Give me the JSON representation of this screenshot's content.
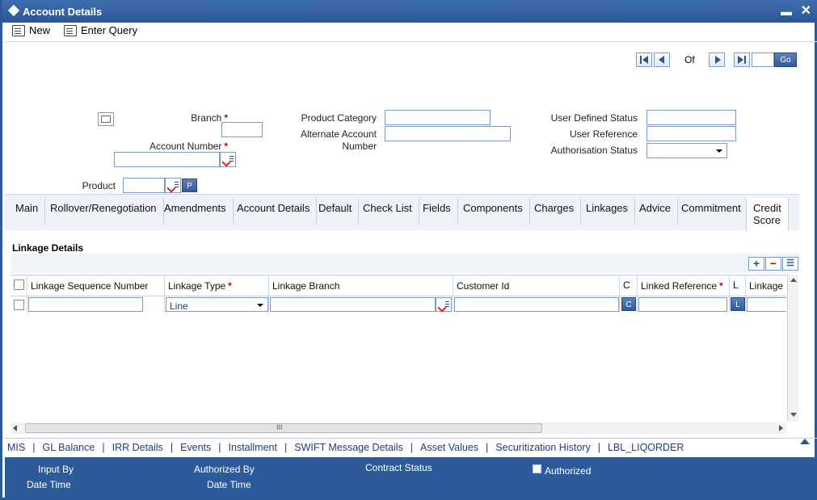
{
  "window": {
    "title": "Account Details"
  },
  "toolbar": {
    "new_label": "New",
    "enter_query_label": "Enter Query"
  },
  "pagination": {
    "of_label": "Of",
    "go_label": "Go"
  },
  "header_fields": {
    "branch_label": "Branch",
    "account_number_label": "Account Number",
    "product_label": "Product",
    "product_p_label": "P",
    "product_category_label": "Product Category",
    "alternate_account_number_label_1": "Alternate Account",
    "alternate_account_number_label_2": "Number",
    "user_defined_status_label": "User Defined Status",
    "user_reference_label": "User Reference",
    "authorisation_status_label": "Authorisation Status"
  },
  "tabs": [
    {
      "label": "Main"
    },
    {
      "label": "Rollover/Renegotiation"
    },
    {
      "label": "Amendments"
    },
    {
      "label": "Account Details"
    },
    {
      "label": "Default"
    },
    {
      "label": "Check List"
    },
    {
      "label": "Fields"
    },
    {
      "label": "Components"
    },
    {
      "label": "Charges"
    },
    {
      "label": "Linkages"
    },
    {
      "label": "Advice"
    },
    {
      "label": "Commitment"
    },
    {
      "label": "Credit"
    },
    {
      "label": "Score"
    }
  ],
  "linkage": {
    "section_title": "Linkage Details",
    "columns": [
      "Linkage Sequence Number",
      "Linkage Type",
      "Linkage Branch",
      "Customer Id",
      "C",
      "Linked Reference",
      "L",
      "Linkage"
    ],
    "row": {
      "linkage_type_value": "Line",
      "c_btn": "C",
      "l_btn": "L"
    },
    "scroll_grip": "III"
  },
  "links": [
    "MIS",
    "GL Balance",
    "IRR Details",
    "Events",
    "Installment",
    "SWIFT Message Details",
    "Asset Values",
    "Securitization History",
    "LBL_LIQORDER"
  ],
  "link_separator": "|",
  "footer": {
    "input_by": "Input By",
    "date_time_1": "Date Time",
    "authorized_by": "Authorized By",
    "date_time_2": "Date Time",
    "contract_status": "Contract Status",
    "authorized": "Authorized"
  }
}
